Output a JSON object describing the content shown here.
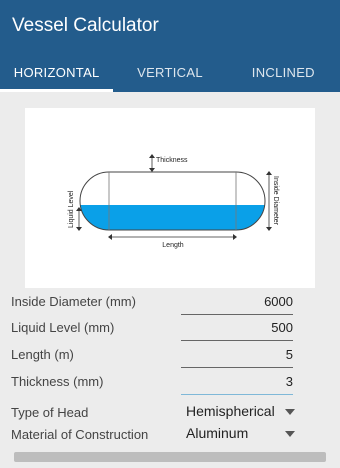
{
  "app": {
    "title": "Vessel Calculator"
  },
  "tabs": [
    {
      "label": "HORIZONTAL",
      "active": true
    },
    {
      "label": "VERTICAL",
      "active": false
    },
    {
      "label": "INCLINED",
      "active": false
    }
  ],
  "diagram": {
    "thickness_label": "Thickness",
    "liquid_level_label": "Liquid Level",
    "inside_diameter_label": "Inside Diameter",
    "length_label": "Length",
    "liquid_color": "#0aa0e8"
  },
  "fields": {
    "inside_diameter": {
      "label": "Inside Diameter (mm)",
      "value": "6000"
    },
    "liquid_level": {
      "label": "Liquid Level (mm)",
      "value": "500"
    },
    "length": {
      "label": "Length (m)",
      "value": "5"
    },
    "thickness": {
      "label": "Thickness (mm)",
      "value": "3"
    }
  },
  "selects": {
    "type_of_head": {
      "label": "Type of Head",
      "value": "Hemispherical"
    },
    "material": {
      "label": "Material of Construction",
      "value": "Aluminum"
    }
  },
  "colors": {
    "appbar": "#235c8c",
    "background": "#ececec"
  }
}
